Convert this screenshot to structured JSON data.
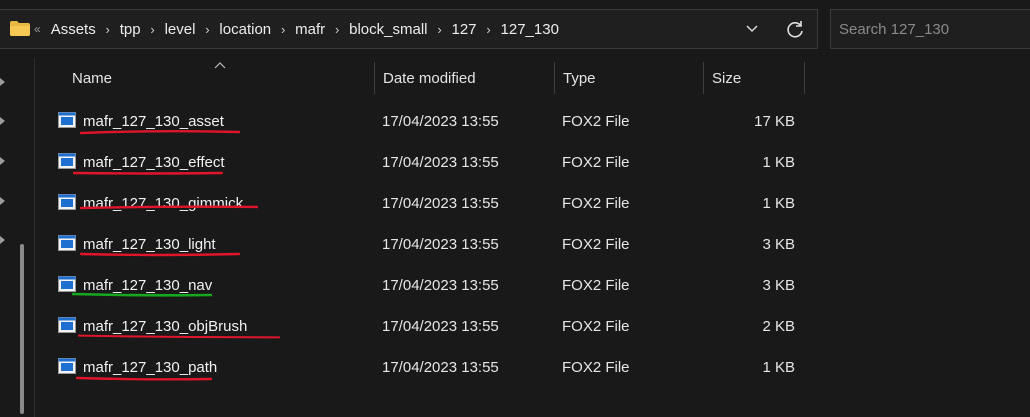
{
  "address_bar": {
    "overflow_glyph": "«",
    "path": [
      "Assets",
      "tpp",
      "level",
      "location",
      "mafr",
      "block_small",
      "127",
      "127_130"
    ],
    "separator_glyph": "›",
    "icons": {
      "folder": "folder-icon",
      "dropdown": "chevron-down-icon",
      "refresh": "refresh-icon"
    }
  },
  "search": {
    "placeholder": "Search 127_130",
    "value": ""
  },
  "columns": {
    "name": "Name",
    "date": "Date modified",
    "type": "Type",
    "size": "Size",
    "sorted_by": "name"
  },
  "files": [
    {
      "name": "mafr_127_130_asset",
      "date": "17/04/2023 13:55",
      "type": "FOX2 File",
      "size": "17 KB",
      "mark": "red"
    },
    {
      "name": "mafr_127_130_effect",
      "date": "17/04/2023 13:55",
      "type": "FOX2 File",
      "size": "1 KB",
      "mark": "red"
    },
    {
      "name": "mafr_127_130_gimmick",
      "date": "17/04/2023 13:55",
      "type": "FOX2 File",
      "size": "1 KB",
      "mark": "red"
    },
    {
      "name": "mafr_127_130_light",
      "date": "17/04/2023 13:55",
      "type": "FOX2 File",
      "size": "3 KB",
      "mark": "red"
    },
    {
      "name": "mafr_127_130_nav",
      "date": "17/04/2023 13:55",
      "type": "FOX2 File",
      "size": "3 KB",
      "mark": "green"
    },
    {
      "name": "mafr_127_130_objBrush",
      "date": "17/04/2023 13:55",
      "type": "FOX2 File",
      "size": "2 KB",
      "mark": "red"
    },
    {
      "name": "mafr_127_130_path",
      "date": "17/04/2023 13:55",
      "type": "FOX2 File",
      "size": "1 KB",
      "mark": "red"
    }
  ],
  "colors": {
    "background": "#191919",
    "annotation_red": "#e0152b",
    "annotation_green": "#17a81f",
    "file_icon_blue": "#1f6fd1"
  }
}
